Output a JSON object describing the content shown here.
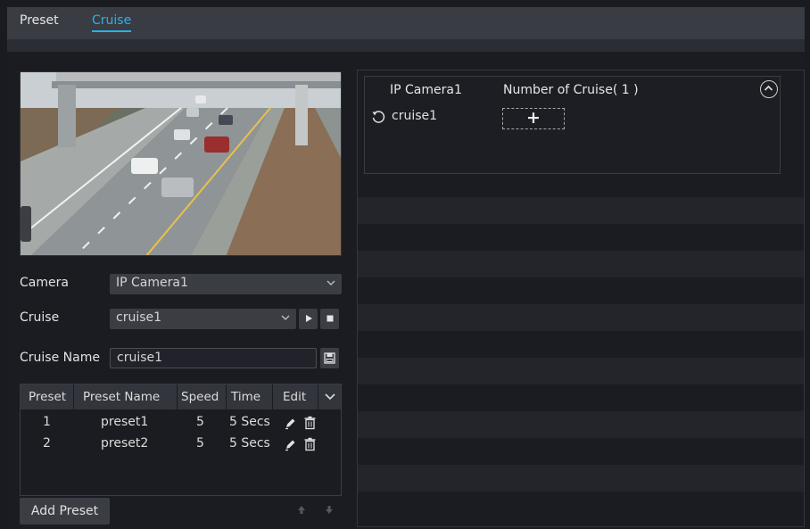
{
  "tabs": {
    "preset": "Preset",
    "cruise": "Cruise"
  },
  "left": {
    "camera": {
      "label": "Camera",
      "value": "IP Camera1"
    },
    "cruise": {
      "label": "Cruise",
      "value": "cruise1"
    },
    "cruise_name": {
      "label": "Cruise Name",
      "value": "cruise1"
    },
    "table": {
      "headers": [
        "Preset",
        "Preset Name",
        "Speed",
        "Time",
        "Edit"
      ],
      "rows": [
        {
          "preset": "1",
          "name": "preset1",
          "speed": "5",
          "time": "5 Secs"
        },
        {
          "preset": "2",
          "name": "preset2",
          "speed": "5",
          "time": "5 Secs"
        }
      ]
    },
    "add_preset_label": "Add Preset"
  },
  "right": {
    "header_camera": "IP Camera1",
    "header_count": "Number of Cruise( 1 )",
    "cruises": [
      "cruise1"
    ]
  },
  "icons": [
    "play-icon",
    "stop-icon",
    "save-icon",
    "edit-icon",
    "delete-icon",
    "chevron-down-icon",
    "chevron-up-icon",
    "arrow-up-icon",
    "arrow-down-icon",
    "refresh-icon",
    "plus-icon"
  ],
  "colors": {
    "accent": "#27b3e8",
    "panel": "#3b3d45",
    "background": "#1b1c21"
  }
}
